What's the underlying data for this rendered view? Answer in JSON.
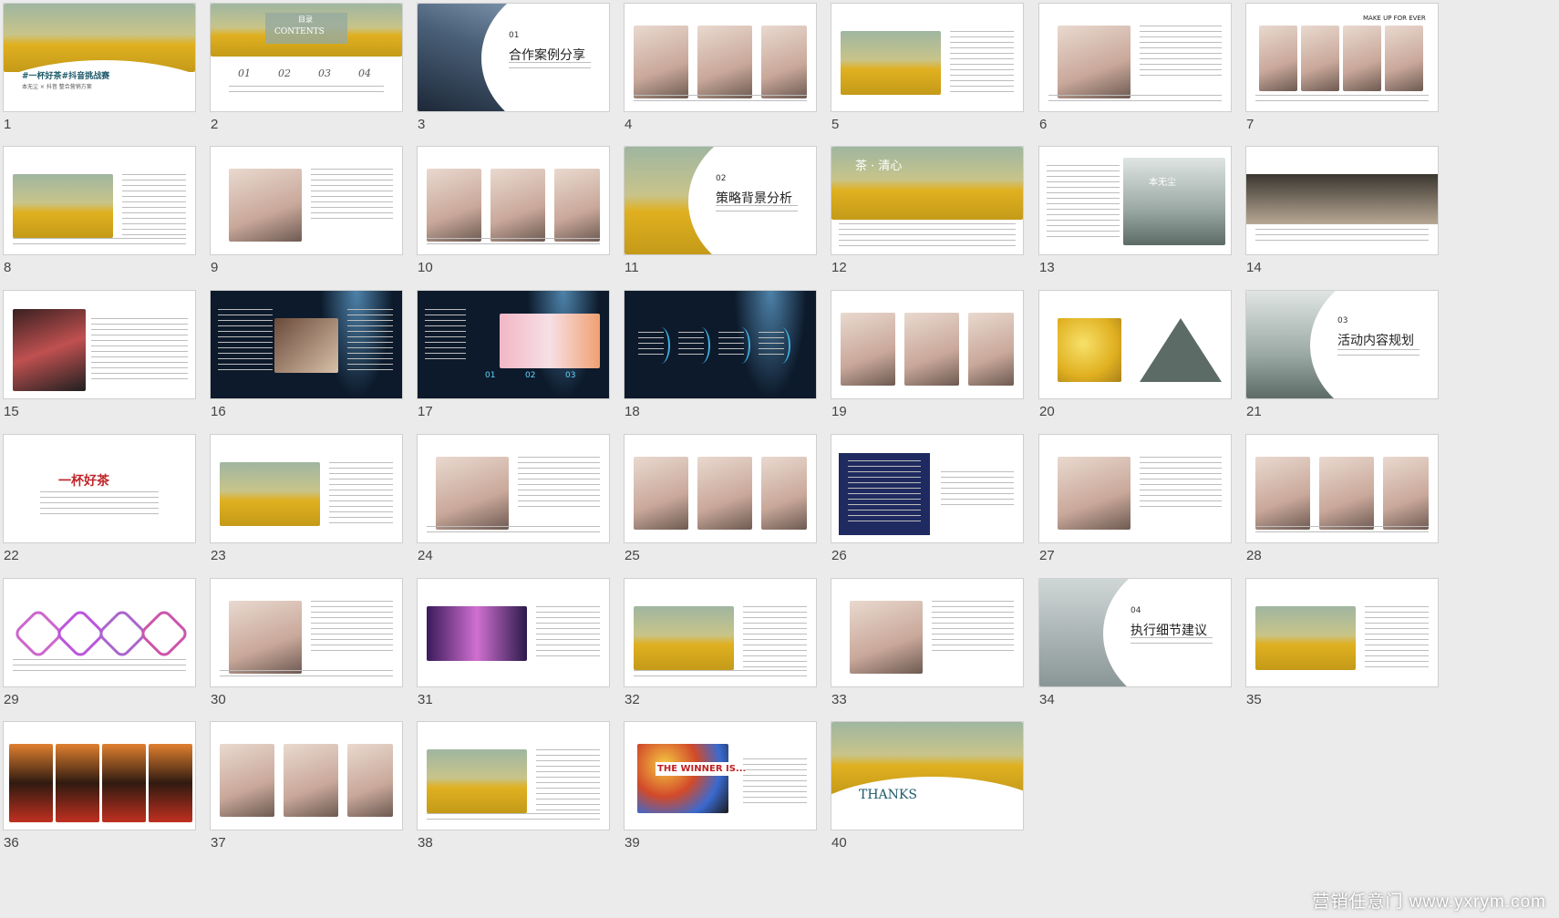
{
  "watermark": "营销任意门 www.yxrym.com",
  "slides": [
    {
      "n": "1",
      "title": "#一杯好茶#抖音挑战赛",
      "sub": "本无尘 × 抖音 整合营销方案"
    },
    {
      "n": "2",
      "title": "目录",
      "sub": "CONTENTS",
      "items": [
        "01",
        "02",
        "03",
        "04"
      ]
    },
    {
      "n": "3",
      "sec": "01",
      "title": "合作案例分享"
    },
    {
      "n": "4"
    },
    {
      "n": "5"
    },
    {
      "n": "6"
    },
    {
      "n": "7",
      "title": "MAKE UP FOR EVER"
    },
    {
      "n": "8"
    },
    {
      "n": "9"
    },
    {
      "n": "10"
    },
    {
      "n": "11",
      "sec": "02",
      "title": "策略背景分析"
    },
    {
      "n": "12",
      "title": "茶 · 清心"
    },
    {
      "n": "13",
      "title": "本无尘"
    },
    {
      "n": "14"
    },
    {
      "n": "15"
    },
    {
      "n": "16"
    },
    {
      "n": "17",
      "items": [
        "01",
        "02",
        "03"
      ]
    },
    {
      "n": "18"
    },
    {
      "n": "19"
    },
    {
      "n": "20"
    },
    {
      "n": "21",
      "sec": "03",
      "title": "活动内容规划"
    },
    {
      "n": "22",
      "title": "一杯好茶"
    },
    {
      "n": "23"
    },
    {
      "n": "24"
    },
    {
      "n": "25"
    },
    {
      "n": "26"
    },
    {
      "n": "27"
    },
    {
      "n": "28"
    },
    {
      "n": "29"
    },
    {
      "n": "30"
    },
    {
      "n": "31"
    },
    {
      "n": "32"
    },
    {
      "n": "33"
    },
    {
      "n": "34",
      "sec": "04",
      "title": "执行细节建议"
    },
    {
      "n": "35"
    },
    {
      "n": "36"
    },
    {
      "n": "37"
    },
    {
      "n": "38"
    },
    {
      "n": "39",
      "title": "THE WINNER IS..."
    },
    {
      "n": "40",
      "title": "THANKS"
    }
  ],
  "colors": {
    "accent": "#1e5a6b",
    "flower": "#e0b020",
    "dark": "#0d1a2b",
    "red": "#c0282d"
  }
}
